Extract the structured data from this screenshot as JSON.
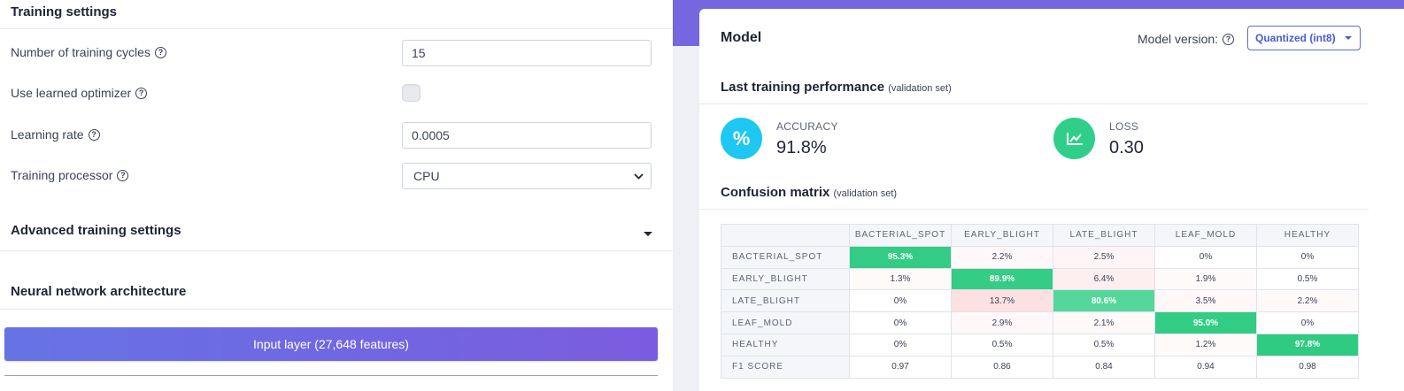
{
  "left": {
    "training_settings_title": "Training settings",
    "cycles_label": "Number of training cycles",
    "cycles_value": "15",
    "optimizer_label": "Use learned optimizer",
    "optimizer_checked": false,
    "lr_label": "Learning rate",
    "lr_value": "0.0005",
    "processor_label": "Training processor",
    "processor_value": "CPU",
    "advanced_title": "Advanced training settings",
    "nn_title": "Neural network architecture",
    "input_layer_label": "Input layer (27,648 features)"
  },
  "model": {
    "title": "Model",
    "version_label": "Model version:",
    "version_value": "Quantized (int8)",
    "performance_title": "Last training performance",
    "performance_note": "(validation set)",
    "accuracy_label": "ACCURACY",
    "accuracy_value": "91.8%",
    "accuracy_icon": "%",
    "loss_label": "LOSS",
    "loss_value": "0.30",
    "confusion_title": "Confusion matrix",
    "confusion_note": "(validation set)"
  },
  "colors": {
    "accent": "#7467e0",
    "accuracy_icon_bg": "#1ec8f0",
    "loss_icon_bg": "#2fcf8a",
    "cell_high": "#33cc84",
    "cell_mid": "#55d69a",
    "cell_pink_strong": "#fde0e2",
    "cell_pink_light": "#fff4f5"
  },
  "matrix": {
    "columns": [
      "BACTERIAL_SPOT",
      "EARLY_BLIGHT",
      "LATE_BLIGHT",
      "LEAF_MOLD",
      "HEALTHY"
    ],
    "rows": [
      {
        "label": "BACTERIAL_SPOT",
        "cells": [
          "95.3%",
          "2.2%",
          "2.5%",
          "0%",
          "0%"
        ]
      },
      {
        "label": "EARLY_BLIGHT",
        "cells": [
          "1.3%",
          "89.9%",
          "6.4%",
          "1.9%",
          "0.5%"
        ]
      },
      {
        "label": "LATE_BLIGHT",
        "cells": [
          "0%",
          "13.7%",
          "80.6%",
          "3.5%",
          "2.2%"
        ]
      },
      {
        "label": "LEAF_MOLD",
        "cells": [
          "0%",
          "2.9%",
          "2.1%",
          "95.0%",
          "0%"
        ]
      },
      {
        "label": "HEALTHY",
        "cells": [
          "0%",
          "0.5%",
          "0.5%",
          "1.2%",
          "97.8%"
        ]
      }
    ],
    "f1_label": "F1 SCORE",
    "f1": [
      "0.97",
      "0.86",
      "0.84",
      "0.94",
      "0.98"
    ]
  }
}
